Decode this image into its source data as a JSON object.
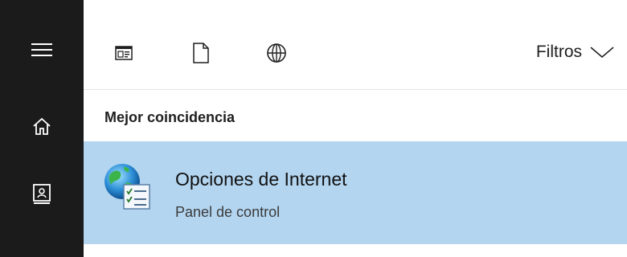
{
  "filters": {
    "label": "Filtros"
  },
  "section": {
    "title": "Mejor coincidencia"
  },
  "best_match": {
    "title": "Opciones de Internet",
    "subtitle": "Panel de control",
    "icon": "internet-options-icon"
  },
  "rail": {
    "items": [
      "hamburger-menu-icon",
      "home-icon",
      "notebook-icon"
    ]
  },
  "toolbar": {
    "icons": [
      "apps-filter-icon",
      "documents-filter-icon",
      "web-filter-icon",
      "chevron-down-icon"
    ]
  },
  "colors": {
    "rail_bg": "#1b1b1b",
    "highlight": "#b3d5f0",
    "text": "#1f1f1f",
    "subtext": "#3b3b3b"
  }
}
